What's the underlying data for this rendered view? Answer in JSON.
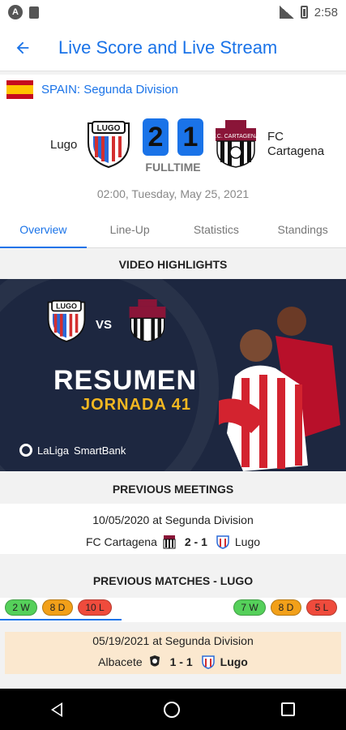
{
  "status_bar": {
    "time": "2:58",
    "icons": [
      "app-icon",
      "sd-card-icon",
      "signal-icon",
      "battery-icon"
    ]
  },
  "app_bar": {
    "title": "Live Score and Live Stream",
    "back_icon": "arrow-left-icon"
  },
  "league": {
    "flag": "spain-flag",
    "name": "SPAIN: Segunda Division"
  },
  "match": {
    "home_team": "Lugo",
    "away_team": "FC Cartagena",
    "home_score": "2",
    "away_score": "1",
    "status": "FULLTIME",
    "datetime": "02:00, Tuesday, May 25, 2021"
  },
  "tabs": [
    {
      "label": "Overview",
      "active": true
    },
    {
      "label": "Line-Up",
      "active": false
    },
    {
      "label": "Statistics",
      "active": false
    },
    {
      "label": "Standings",
      "active": false
    }
  ],
  "video_highlights": {
    "header": "VIDEO HIGHLIGHTS",
    "vs_text": "VS",
    "title": "RESUMEN",
    "subtitle": "JORNADA 41",
    "brand_left": "LaLiga",
    "brand_right": "SmartBank"
  },
  "previous_meetings": {
    "header": "PREVIOUS MEETINGS",
    "date_line": "10/05/2020 at Segunda Division",
    "home": "FC Cartagena",
    "score": "2 - 1",
    "away": "Lugo"
  },
  "previous_matches": {
    "header": "PREVIOUS MATCHES - LUGO",
    "form_left": {
      "w": "2 W",
      "d": "8 D",
      "l": "10 L"
    },
    "form_right": {
      "w": "7 W",
      "d": "8 D",
      "l": "5 L"
    },
    "match": {
      "date_line": "05/19/2021 at Segunda Division",
      "home": "Albacete",
      "score": "1 - 1",
      "away": "Lugo"
    }
  },
  "colors": {
    "accent": "#1a73e8",
    "win": "#55d05a",
    "draw": "#f2a019",
    "loss": "#ef4b3c",
    "highlight_row": "#fbe8cf"
  }
}
